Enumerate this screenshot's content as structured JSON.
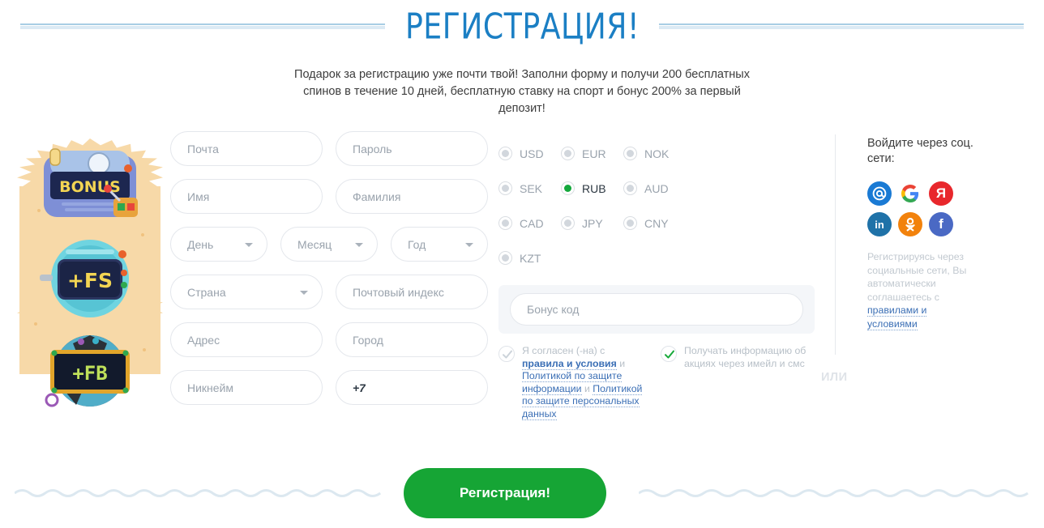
{
  "header": {
    "title": "РЕГИСТРАЦИЯ!",
    "subtitle": "Подарок за регистрацию уже почти твой! Заполни форму и получи 200 бесплатных спинов в течение 10 дней, бесплатную ставку на спорт и бонус 200% за первый депозит!"
  },
  "bonus_art": {
    "panels": [
      "BONUS",
      "+FS",
      "+FB"
    ]
  },
  "form": {
    "fields": [
      {
        "name": "email",
        "placeholder": "Почта",
        "value": "",
        "type": "text"
      },
      {
        "name": "password",
        "placeholder": "Пароль",
        "value": "",
        "type": "text"
      },
      {
        "name": "first-name",
        "placeholder": "Имя",
        "value": "",
        "type": "text"
      },
      {
        "name": "last-name",
        "placeholder": "Фамилия",
        "value": "",
        "type": "text"
      },
      {
        "name": "day",
        "placeholder": "День",
        "value": "",
        "type": "select"
      },
      {
        "name": "month",
        "placeholder": "Месяц",
        "value": "",
        "type": "select"
      },
      {
        "name": "year",
        "placeholder": "Год",
        "value": "",
        "type": "select"
      },
      {
        "name": "country",
        "placeholder": "Страна",
        "value": "",
        "type": "select"
      },
      {
        "name": "postcode",
        "placeholder": "Почтовый индекс",
        "value": "",
        "type": "text"
      },
      {
        "name": "address",
        "placeholder": "Адрес",
        "value": "",
        "type": "text"
      },
      {
        "name": "city",
        "placeholder": "Город",
        "value": "",
        "type": "text"
      },
      {
        "name": "nickname",
        "placeholder": "Никнейм",
        "value": "",
        "type": "text"
      },
      {
        "name": "phone",
        "placeholder": "",
        "value": "+7",
        "type": "text"
      }
    ]
  },
  "currency": {
    "selected": "RUB",
    "options": [
      "USD",
      "EUR",
      "NOK",
      "SEK",
      "RUB",
      "AUD",
      "CAD",
      "JPY",
      "CNY",
      "KZT"
    ]
  },
  "bonus_code": {
    "placeholder": "Бонус код",
    "value": ""
  },
  "consents": [
    {
      "name": "terms",
      "checked": false,
      "parts": [
        {
          "text": "Я согласен (-на) с ",
          "link": false
        },
        {
          "text": "правила и условия",
          "link": true,
          "bold": true
        },
        {
          "text": " и ",
          "link": false
        },
        {
          "text": "Политикой по защите информации",
          "link": true,
          "bold": false
        },
        {
          "text": " и ",
          "link": false
        },
        {
          "text": "Политикой по защите персональных данных",
          "link": true,
          "bold": false
        }
      ]
    },
    {
      "name": "marketing",
      "checked": true,
      "parts": [
        {
          "text": "Получать информацию об акциях через имейл и смс",
          "link": false
        }
      ]
    }
  ],
  "social": {
    "or_label": "ИЛИ",
    "title": "Войдите через соц. сети:",
    "icons": [
      {
        "name": "mailru-icon",
        "glyph": "@",
        "color": "#1a7ad4"
      },
      {
        "name": "google-icon",
        "glyph": "G",
        "color": "#ffffff"
      },
      {
        "name": "yandex-icon",
        "glyph": "Я",
        "color": "#e8272c"
      },
      {
        "name": "linkedin-icon",
        "glyph": "in",
        "color": "#1f72a8"
      },
      {
        "name": "odnoklassniki-icon",
        "glyph": "ок",
        "color": "#f2820c"
      },
      {
        "name": "facebook-icon",
        "glyph": "f",
        "color": "#4a69c4"
      }
    ],
    "note_parts": [
      {
        "text": "Регистрируясь через социальные сети, Вы автоматически соглашаетесь с ",
        "link": false
      },
      {
        "text": "правилами и условиями",
        "link": true
      }
    ]
  },
  "footer": {
    "submit_label": "Регистрация!",
    "accent_green": "#16a535"
  }
}
